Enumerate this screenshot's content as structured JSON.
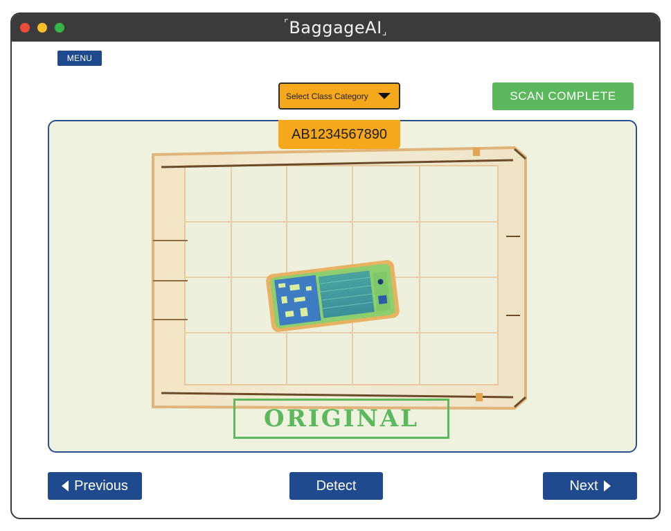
{
  "app": {
    "title": "BaggageAI",
    "title_bracket_open": "⌜",
    "title_bracket_close": "⌟"
  },
  "toolbar": {
    "menu_label": "MENU",
    "select_class_label": "Select Class Category",
    "scan_status_label": "SCAN COMPLETE"
  },
  "viewer": {
    "scan_id": "AB1234567890",
    "stamp_label": "ORIGINAL",
    "image_content": "x-ray-tray-with-smartphone"
  },
  "navigation": {
    "previous_label": "Previous",
    "detect_label": "Detect",
    "next_label": "Next"
  },
  "colors": {
    "titlebar": "#3b3b3b",
    "primary_blue": "#1f4a8e",
    "accent_orange": "#f5a81c",
    "success_green": "#5cb85c",
    "viewer_bg": "#eef2df"
  },
  "icons": {
    "previous": "caret-left-icon",
    "next": "caret-right-icon",
    "dropdown": "caret-down-icon"
  }
}
